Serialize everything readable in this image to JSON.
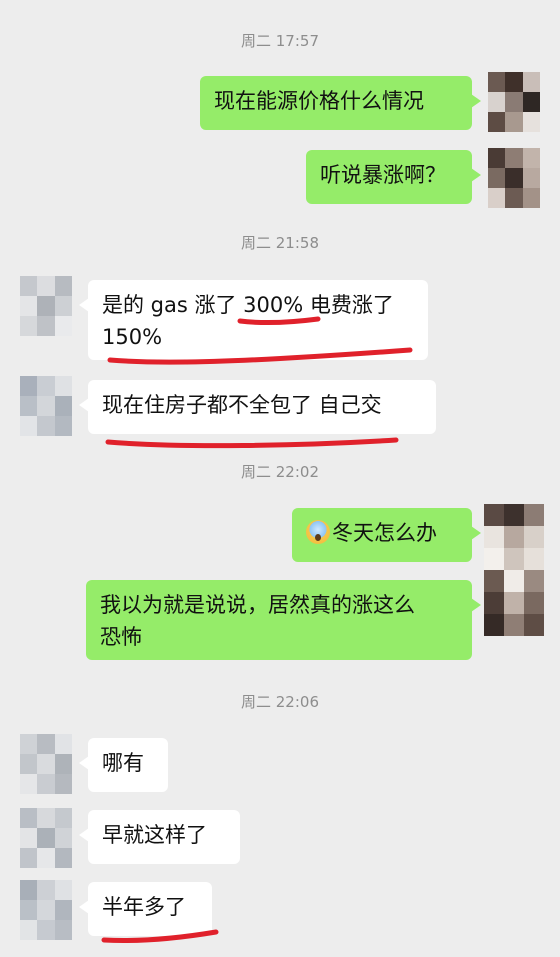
{
  "conversation": {
    "timestamps": [
      "周二 17:57",
      "周二 21:58",
      "周二 22:02",
      "周二 22:06"
    ],
    "messages": [
      {
        "side": "right",
        "text": "现在能源价格什么情况"
      },
      {
        "side": "right",
        "text": "听说暴涨啊？"
      },
      {
        "side": "left",
        "text_line1": "是的 gas 涨了 300% 电费涨了",
        "text_line2": "150%"
      },
      {
        "side": "left",
        "text": "现在住房子都不全包了 自己交"
      },
      {
        "side": "right",
        "emoji": "screaming-face",
        "text": "冬天怎么办"
      },
      {
        "side": "right",
        "text_line1": "我以为就是说说，居然真的涨这么",
        "text_line2": "恐怖"
      },
      {
        "side": "left",
        "text": "哪有"
      },
      {
        "side": "left",
        "text": "早就这样了"
      },
      {
        "side": "left",
        "text": "半年多了"
      }
    ]
  },
  "colors": {
    "background": "#ededed",
    "bubble_self": "#95ec69",
    "bubble_other": "#ffffff",
    "timestamp": "#8d8d8d",
    "underline_annotation": "#e0212b"
  }
}
